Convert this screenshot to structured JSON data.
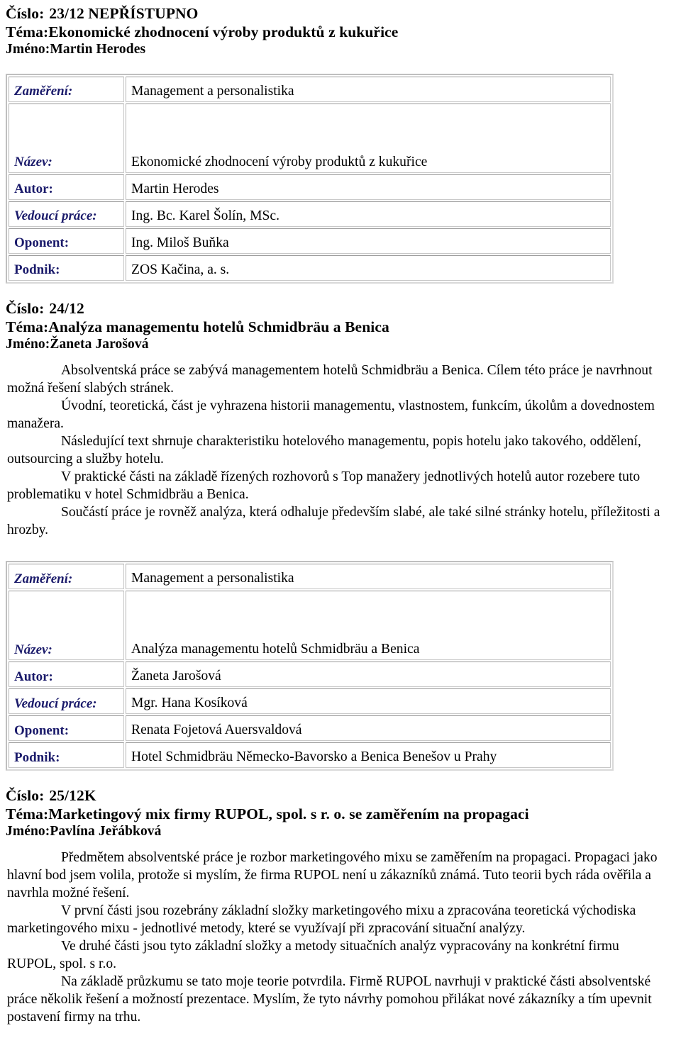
{
  "document": {
    "language": "cs",
    "label_color": "#1b1b6b",
    "text_color": "#000000",
    "background": "#ffffff"
  },
  "field_labels": {
    "cislo": "Číslo:",
    "tema": "Téma:",
    "jmeno": "Jméno:",
    "zamereni": "Zaměření:",
    "nazev": "Název:",
    "autor": "Autor:",
    "vedouci": "Vedoucí práce:",
    "oponent": "Oponent:",
    "podnik": "Podnik:"
  },
  "records": [
    {
      "cislo": "23/12 NEPŘÍSTUPNO",
      "tema": "Ekonomické zhodnocení výroby produktů z kukuřice",
      "jmeno": "Martin Herodes",
      "abstract": [],
      "table": {
        "zamereni": "Management a personalistika",
        "nazev": "Ekonomické zhodnocení výroby produktů z kukuřice",
        "autor": "Martin Herodes",
        "vedouci": "Ing. Bc. Karel Šolín, MSc.",
        "oponent": "Ing. Miloš Buňka",
        "podnik": "ZOS Kačina, a. s."
      }
    },
    {
      "cislo": "24/12",
      "tema": "Analýza managementu hotelů Schmidbräu a Benica",
      "jmeno": "Žaneta Jarošová",
      "abstract": [
        "Absolventská práce se zabývá managementem hotelů Schmidbräu a Benica. Cílem této práce je navrhnout možná řešení slabých stránek.",
        "Úvodní, teoretická, část je vyhrazena historii managementu, vlastnostem, funkcím, úkolům a dovednostem manažera.",
        "Následující text shrnuje charakteristiku hotelového managementu, popis hotelu jako takového, oddělení, outsourcing a služby hotelu.",
        "V praktické části na základě řízených rozhovorů s Top manažery jednotlivých hotelů autor rozebere tuto problematiku v hotel Schmidbräu a Benica.",
        "Součástí práce je rovněž analýza, která odhaluje především slabé, ale také silné stránky hotelu, příležitosti a hrozby."
      ],
      "table": {
        "zamereni": "Management a personalistika",
        "nazev": "Analýza managementu hotelů Schmidbräu a Benica",
        "autor": "Žaneta Jarošová",
        "vedouci": "Mgr. Hana Kosíková",
        "oponent": "Renata Fojetová Auersvaldová",
        "podnik": "Hotel Schmidbräu Německo-Bavorsko a Benica Benešov u Prahy"
      }
    },
    {
      "cislo": "25/12K",
      "tema": "Marketingový mix firmy RUPOL, spol. s r. o. se zaměřením na propagaci",
      "jmeno": "Pavlína Jeřábková",
      "abstract": [
        "Předmětem absolventské práce je rozbor marketingového mixu se zaměřením na propagaci. Propagaci jako hlavní bod jsem volila, protože si myslím, že firma RUPOL není u zákazníků známá. Tuto teorii bych ráda ověřila a navrhla možné řešení.",
        "V první části jsou rozebrány základní složky marketingového mixu a zpracována teoretická východiska marketingového mixu - jednotlivé metody, které se využívají při zpracování situační analýzy.",
        "Ve druhé části jsou tyto základní složky a metody situačních analýz vypracovány na konkrétní firmu RUPOL, spol. s r.o.",
        "Na základě průzkumu se tato moje teorie potvrdila. Firmě RUPOL navrhuji v praktické části absolventské práce několik řešení a možností prezentace. Myslím, že tyto návrhy pomohou přilákat nové zákazníky a tím upevnit postavení firmy na trhu."
      ],
      "table": null
    }
  ]
}
